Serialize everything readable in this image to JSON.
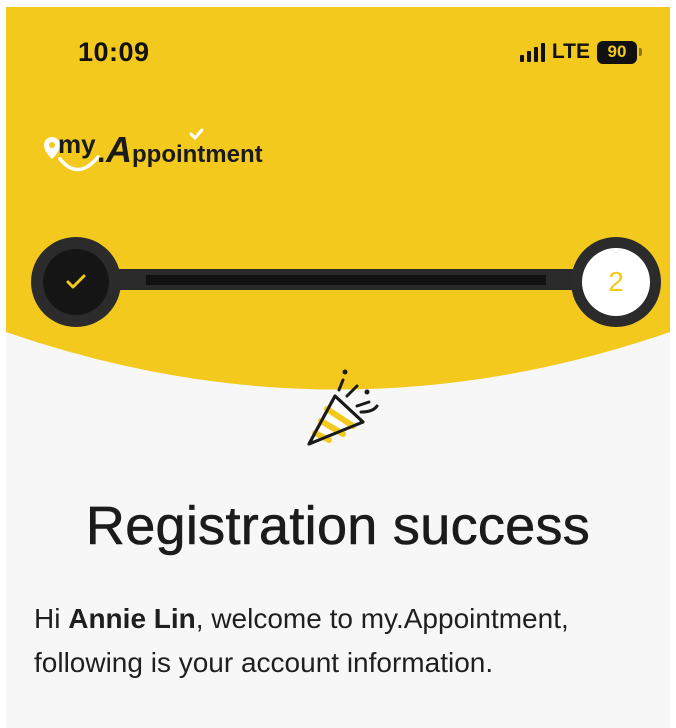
{
  "status_bar": {
    "time": "10:09",
    "network": "LTE",
    "battery": "90"
  },
  "brand": {
    "logo_text_my": "my",
    "logo_text_dot": ".",
    "logo_text_a": "A",
    "logo_text_rest": "ppointment"
  },
  "stepper": {
    "step1_state": "completed",
    "step2_label": "2"
  },
  "main": {
    "title": "Registration success",
    "greeting_prefix": "Hi ",
    "user_name": "Annie Lin",
    "greeting_suffix": ", welcome to my.Appointment,",
    "info_line": "following is your account information."
  },
  "colors": {
    "accent_yellow": "#F2C91C",
    "dark": "#151515",
    "background": "#F7F7F7"
  }
}
